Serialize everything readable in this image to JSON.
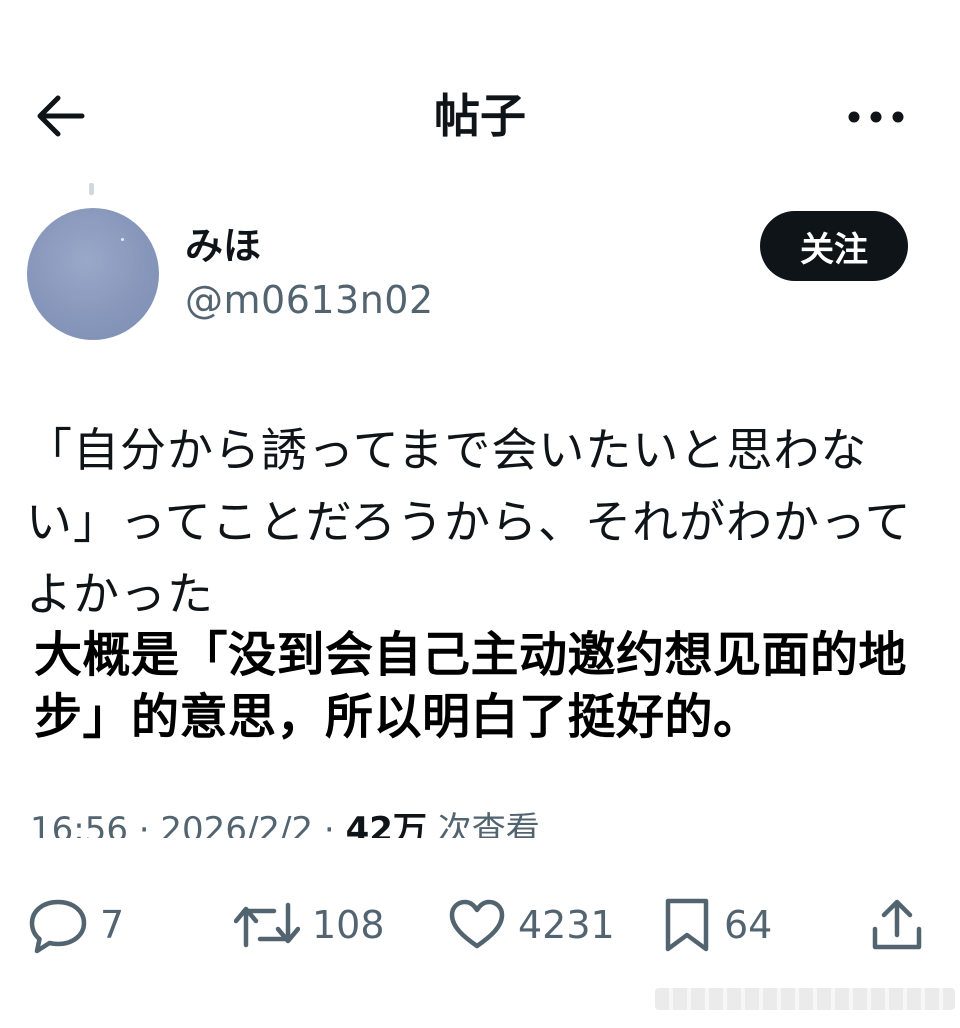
{
  "header": {
    "title": "帖子",
    "back_icon": "arrow-left-icon",
    "more_icon": "more-horizontal-icon"
  },
  "author": {
    "name": "みほ",
    "handle": "@m0613n02",
    "follow_label": "关注"
  },
  "post": {
    "text": "「自分から誘ってまで会いたいと思わない」ってことだろうから、それがわかってよかった"
  },
  "caption": {
    "text": "大概是「没到会自己主动邀约想见面的地步」的意思，所以明白了挺好的。"
  },
  "meta": {
    "time": "16:56",
    "date": "2026/2/2",
    "views_num": "42万",
    "views_label": "次查看"
  },
  "actions": {
    "reply_count": "7",
    "retweet_count": "108",
    "like_count": "4231",
    "bookmark_count": "64",
    "icons": [
      "reply-icon",
      "retweet-icon",
      "heart-icon",
      "bookmark-icon",
      "share-icon"
    ]
  },
  "colors": {
    "text": "#0f1419",
    "secondary": "#536471",
    "button_bg": "#0f1419"
  }
}
